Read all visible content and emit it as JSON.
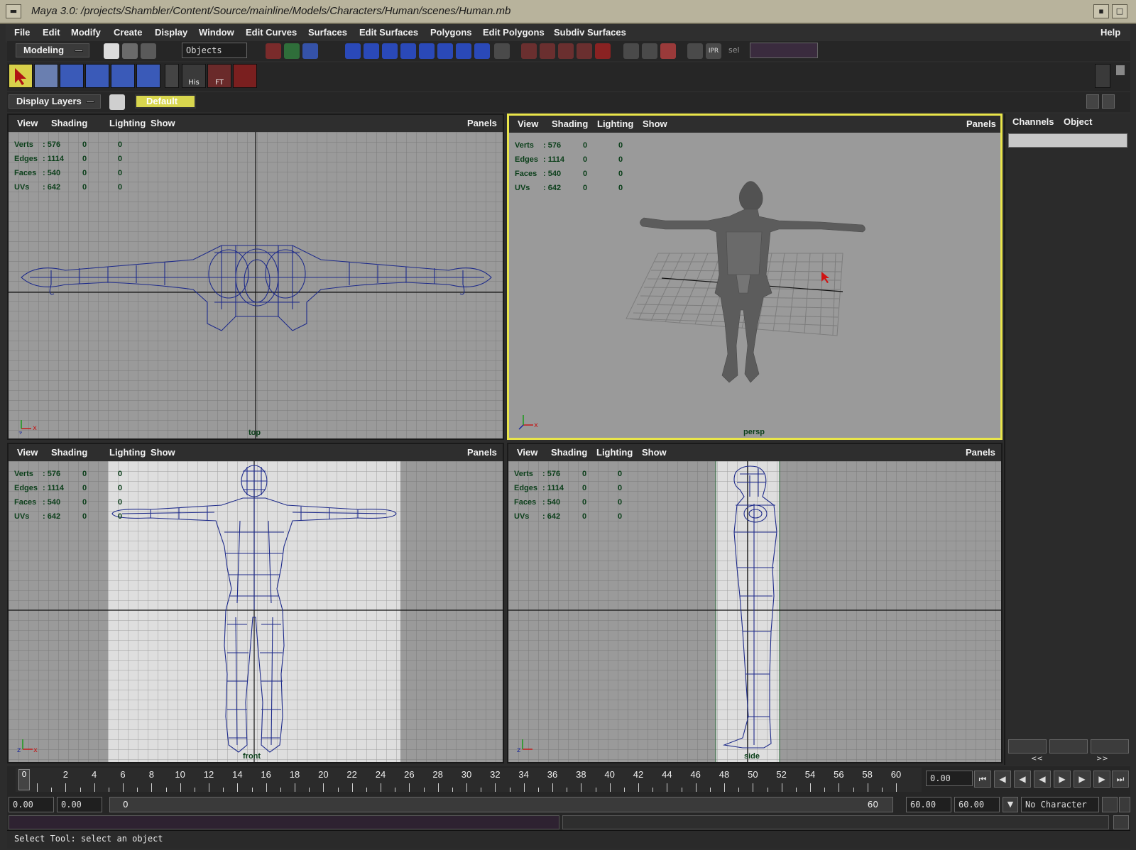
{
  "window": {
    "title": "Maya 3.0: /projects/Shambler/Content/Source/mainline/Models/Characters/Human/scenes/Human.mb"
  },
  "menubar": {
    "items": [
      "File",
      "Edit",
      "Modify",
      "Create",
      "Display",
      "Window",
      "Edit Curves",
      "Surfaces",
      "Edit Surfaces",
      "Polygons",
      "Edit Polygons",
      "Subdiv Surfaces"
    ],
    "help": "Help"
  },
  "statusline": {
    "mode": "Modeling",
    "selection_mask": "Objects",
    "sel_label": "sel",
    "ipr_label": "IPR"
  },
  "shelf": {
    "his_label": "His",
    "ft_label": "FT"
  },
  "layers": {
    "dropdown": "Display Layers",
    "current": "Default"
  },
  "viewports": {
    "menu": {
      "view": "View",
      "shading": "Shading",
      "lighting": "Lighting",
      "show": "Show",
      "panels": "Panels"
    },
    "hud": {
      "verts_label": "Verts",
      "verts": ": 576",
      "edges_label": "Edges",
      "edges": ": 1114",
      "faces_label": "Faces",
      "faces": ": 540",
      "uvs_label": "UVs",
      "uvs": ": 642",
      "zero": "0"
    },
    "names": {
      "top": "top",
      "persp": "persp",
      "front": "front",
      "side": "side"
    }
  },
  "channel_box": {
    "tab_channels": "Channels",
    "tab_object": "Object",
    "prev": "<<",
    "next": ">>"
  },
  "time_slider": {
    "ticks": [
      "2",
      "4",
      "6",
      "8",
      "10",
      "12",
      "14",
      "16",
      "18",
      "20",
      "22",
      "24",
      "26",
      "28",
      "30",
      "32",
      "34",
      "36",
      "38",
      "40",
      "42",
      "44",
      "46",
      "48",
      "50",
      "52",
      "54",
      "56",
      "58",
      "60"
    ],
    "current_frame_marker": "0",
    "current_time": "0.00"
  },
  "range_slider": {
    "start_anim": "0.00",
    "start_range": "0.00",
    "range_start_label": "0",
    "range_end_label": "60",
    "end_range": "60.00",
    "end_anim": "60.00",
    "character": "No Character"
  },
  "help_line": {
    "text": "Select Tool: select an object"
  },
  "colors": {
    "active_panel": "#e9e54a",
    "wireframe": "#1d2a8a",
    "hud_text": "#0b3f1a",
    "viewport_bg": "#9a9a9a"
  }
}
